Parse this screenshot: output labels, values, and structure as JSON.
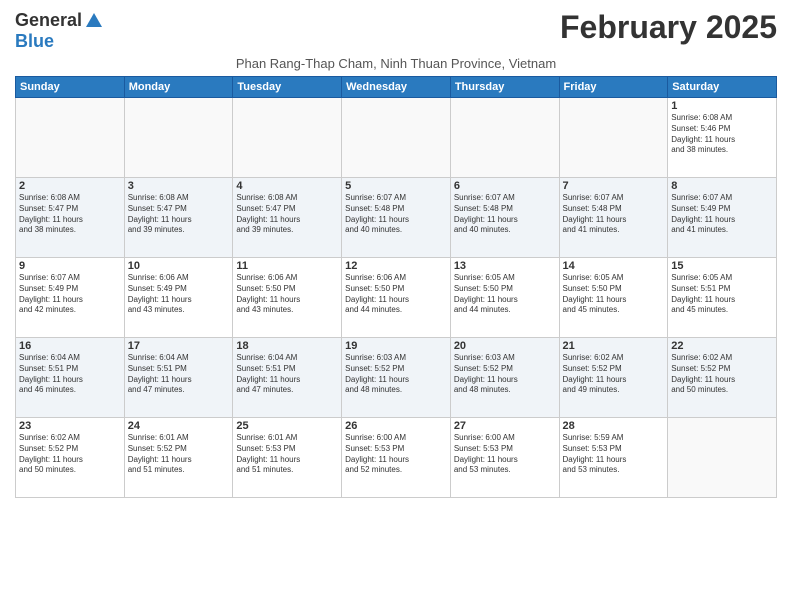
{
  "logo": {
    "general": "General",
    "blue": "Blue"
  },
  "title": {
    "month_year": "February 2025",
    "location": "Phan Rang-Thap Cham, Ninh Thuan Province, Vietnam"
  },
  "weekdays": [
    "Sunday",
    "Monday",
    "Tuesday",
    "Wednesday",
    "Thursday",
    "Friday",
    "Saturday"
  ],
  "weeks": [
    [
      {
        "day": "",
        "info": ""
      },
      {
        "day": "",
        "info": ""
      },
      {
        "day": "",
        "info": ""
      },
      {
        "day": "",
        "info": ""
      },
      {
        "day": "",
        "info": ""
      },
      {
        "day": "",
        "info": ""
      },
      {
        "day": "1",
        "info": "Sunrise: 6:08 AM\nSunset: 5:46 PM\nDaylight: 11 hours\nand 38 minutes."
      }
    ],
    [
      {
        "day": "2",
        "info": "Sunrise: 6:08 AM\nSunset: 5:47 PM\nDaylight: 11 hours\nand 38 minutes."
      },
      {
        "day": "3",
        "info": "Sunrise: 6:08 AM\nSunset: 5:47 PM\nDaylight: 11 hours\nand 39 minutes."
      },
      {
        "day": "4",
        "info": "Sunrise: 6:08 AM\nSunset: 5:47 PM\nDaylight: 11 hours\nand 39 minutes."
      },
      {
        "day": "5",
        "info": "Sunrise: 6:07 AM\nSunset: 5:48 PM\nDaylight: 11 hours\nand 40 minutes."
      },
      {
        "day": "6",
        "info": "Sunrise: 6:07 AM\nSunset: 5:48 PM\nDaylight: 11 hours\nand 40 minutes."
      },
      {
        "day": "7",
        "info": "Sunrise: 6:07 AM\nSunset: 5:48 PM\nDaylight: 11 hours\nand 41 minutes."
      },
      {
        "day": "8",
        "info": "Sunrise: 6:07 AM\nSunset: 5:49 PM\nDaylight: 11 hours\nand 41 minutes."
      }
    ],
    [
      {
        "day": "9",
        "info": "Sunrise: 6:07 AM\nSunset: 5:49 PM\nDaylight: 11 hours\nand 42 minutes."
      },
      {
        "day": "10",
        "info": "Sunrise: 6:06 AM\nSunset: 5:49 PM\nDaylight: 11 hours\nand 43 minutes."
      },
      {
        "day": "11",
        "info": "Sunrise: 6:06 AM\nSunset: 5:50 PM\nDaylight: 11 hours\nand 43 minutes."
      },
      {
        "day": "12",
        "info": "Sunrise: 6:06 AM\nSunset: 5:50 PM\nDaylight: 11 hours\nand 44 minutes."
      },
      {
        "day": "13",
        "info": "Sunrise: 6:05 AM\nSunset: 5:50 PM\nDaylight: 11 hours\nand 44 minutes."
      },
      {
        "day": "14",
        "info": "Sunrise: 6:05 AM\nSunset: 5:50 PM\nDaylight: 11 hours\nand 45 minutes."
      },
      {
        "day": "15",
        "info": "Sunrise: 6:05 AM\nSunset: 5:51 PM\nDaylight: 11 hours\nand 45 minutes."
      }
    ],
    [
      {
        "day": "16",
        "info": "Sunrise: 6:04 AM\nSunset: 5:51 PM\nDaylight: 11 hours\nand 46 minutes."
      },
      {
        "day": "17",
        "info": "Sunrise: 6:04 AM\nSunset: 5:51 PM\nDaylight: 11 hours\nand 47 minutes."
      },
      {
        "day": "18",
        "info": "Sunrise: 6:04 AM\nSunset: 5:51 PM\nDaylight: 11 hours\nand 47 minutes."
      },
      {
        "day": "19",
        "info": "Sunrise: 6:03 AM\nSunset: 5:52 PM\nDaylight: 11 hours\nand 48 minutes."
      },
      {
        "day": "20",
        "info": "Sunrise: 6:03 AM\nSunset: 5:52 PM\nDaylight: 11 hours\nand 48 minutes."
      },
      {
        "day": "21",
        "info": "Sunrise: 6:02 AM\nSunset: 5:52 PM\nDaylight: 11 hours\nand 49 minutes."
      },
      {
        "day": "22",
        "info": "Sunrise: 6:02 AM\nSunset: 5:52 PM\nDaylight: 11 hours\nand 50 minutes."
      }
    ],
    [
      {
        "day": "23",
        "info": "Sunrise: 6:02 AM\nSunset: 5:52 PM\nDaylight: 11 hours\nand 50 minutes."
      },
      {
        "day": "24",
        "info": "Sunrise: 6:01 AM\nSunset: 5:52 PM\nDaylight: 11 hours\nand 51 minutes."
      },
      {
        "day": "25",
        "info": "Sunrise: 6:01 AM\nSunset: 5:53 PM\nDaylight: 11 hours\nand 51 minutes."
      },
      {
        "day": "26",
        "info": "Sunrise: 6:00 AM\nSunset: 5:53 PM\nDaylight: 11 hours\nand 52 minutes."
      },
      {
        "day": "27",
        "info": "Sunrise: 6:00 AM\nSunset: 5:53 PM\nDaylight: 11 hours\nand 53 minutes."
      },
      {
        "day": "28",
        "info": "Sunrise: 5:59 AM\nSunset: 5:53 PM\nDaylight: 11 hours\nand 53 minutes."
      },
      {
        "day": "",
        "info": ""
      }
    ]
  ]
}
